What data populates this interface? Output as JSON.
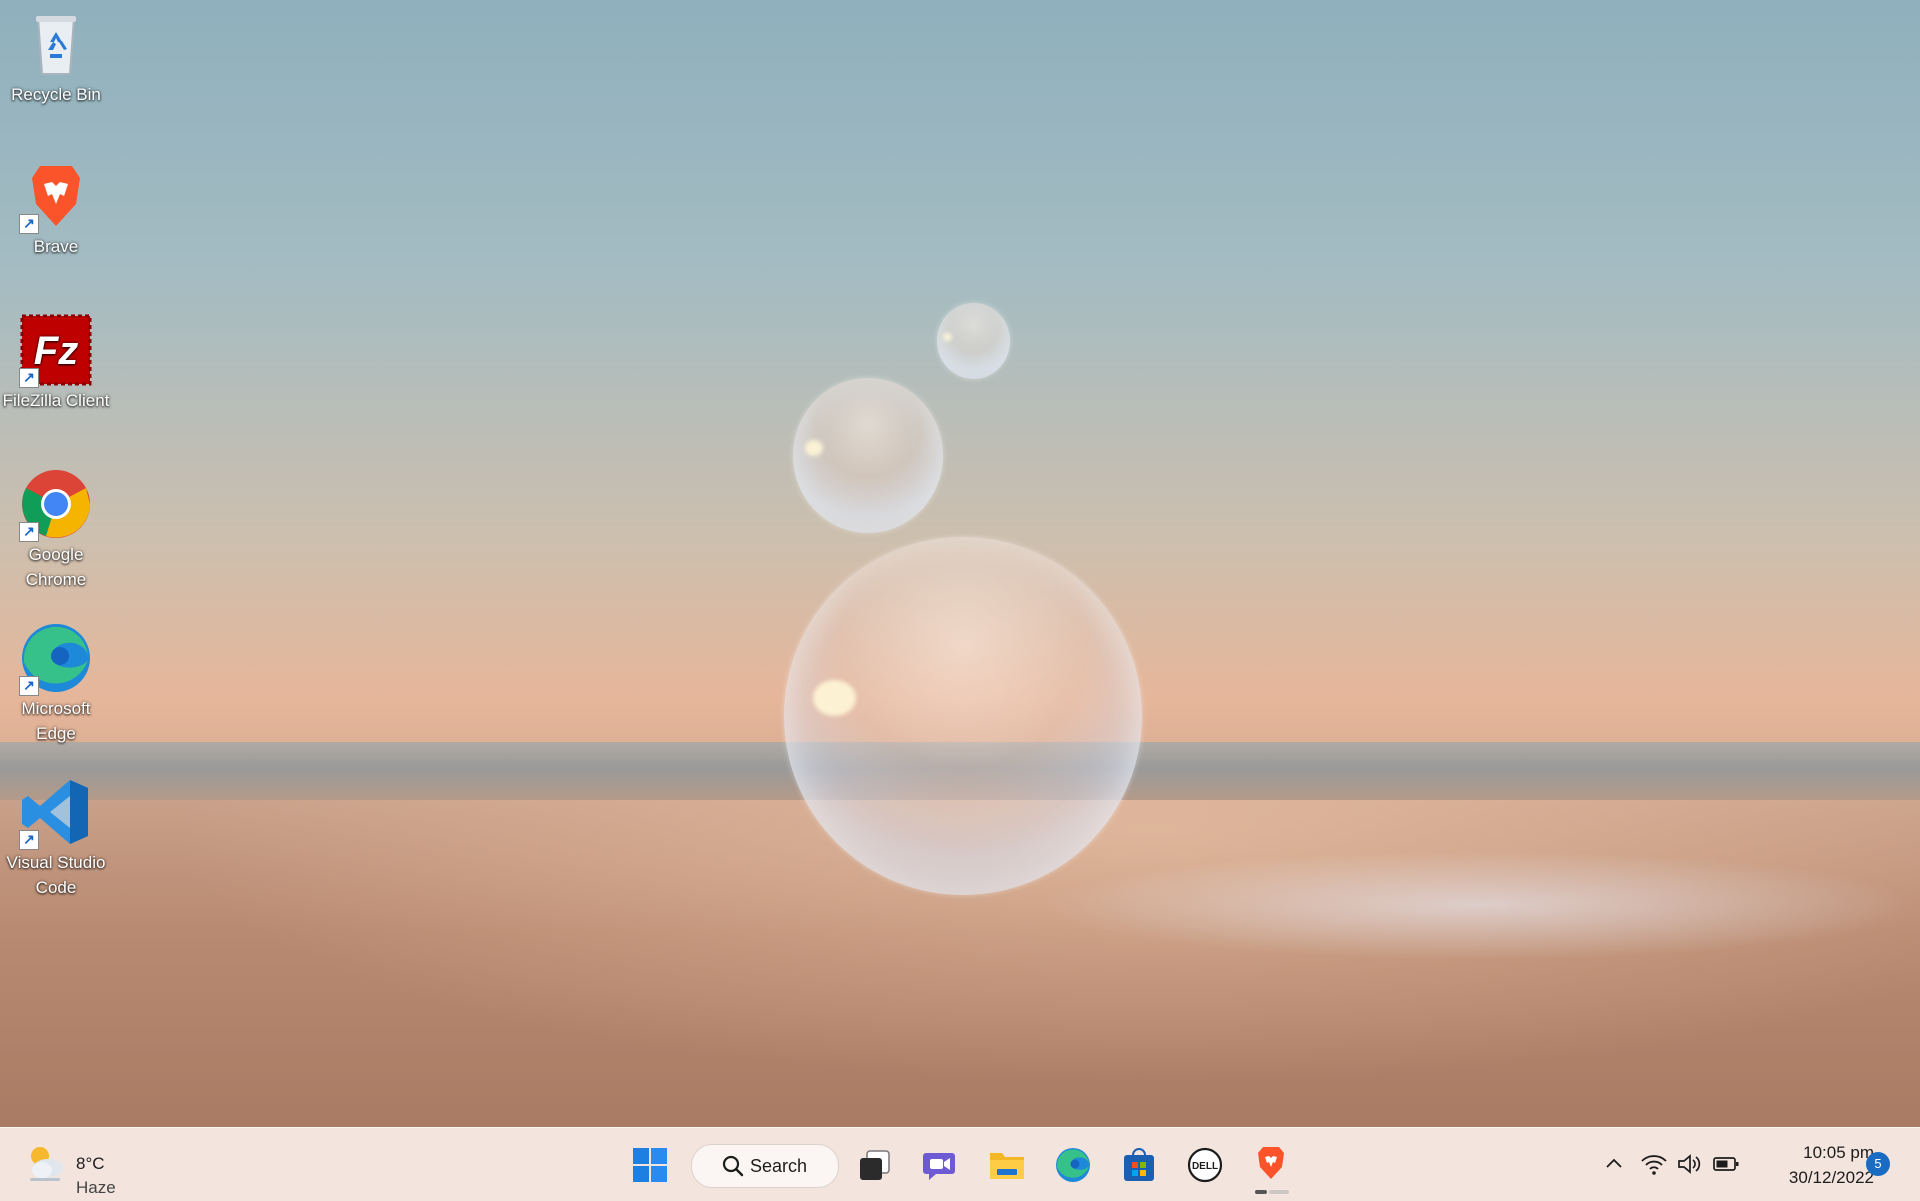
{
  "desktop": {
    "icons": [
      {
        "label": "Recycle Bin",
        "icon": "recycle-bin-icon"
      },
      {
        "label": "Brave",
        "icon": "brave-icon"
      },
      {
        "label": "FileZilla Client",
        "icon": "filezilla-icon"
      },
      {
        "label": "Google Chrome",
        "icon": "chrome-icon"
      },
      {
        "label": "Microsoft Edge",
        "icon": "edge-icon"
      },
      {
        "label": "Visual Studio Code",
        "icon": "vscode-icon"
      }
    ]
  },
  "taskbar": {
    "weather": {
      "temp": "8°C",
      "condition": "Haze"
    },
    "search_label": "Search",
    "apps": [
      "start-icon",
      "task-view-icon",
      "teams-chat-icon",
      "file-explorer-icon",
      "edge-icon",
      "microsoft-store-icon",
      "dell-icon",
      "brave-icon"
    ],
    "tray": {
      "time": "10:05 pm",
      "date": "30/12/2022",
      "notifications": "5"
    }
  },
  "colors": {
    "accent": "#1a6cc2",
    "taskbar": "#f2e4dc"
  }
}
